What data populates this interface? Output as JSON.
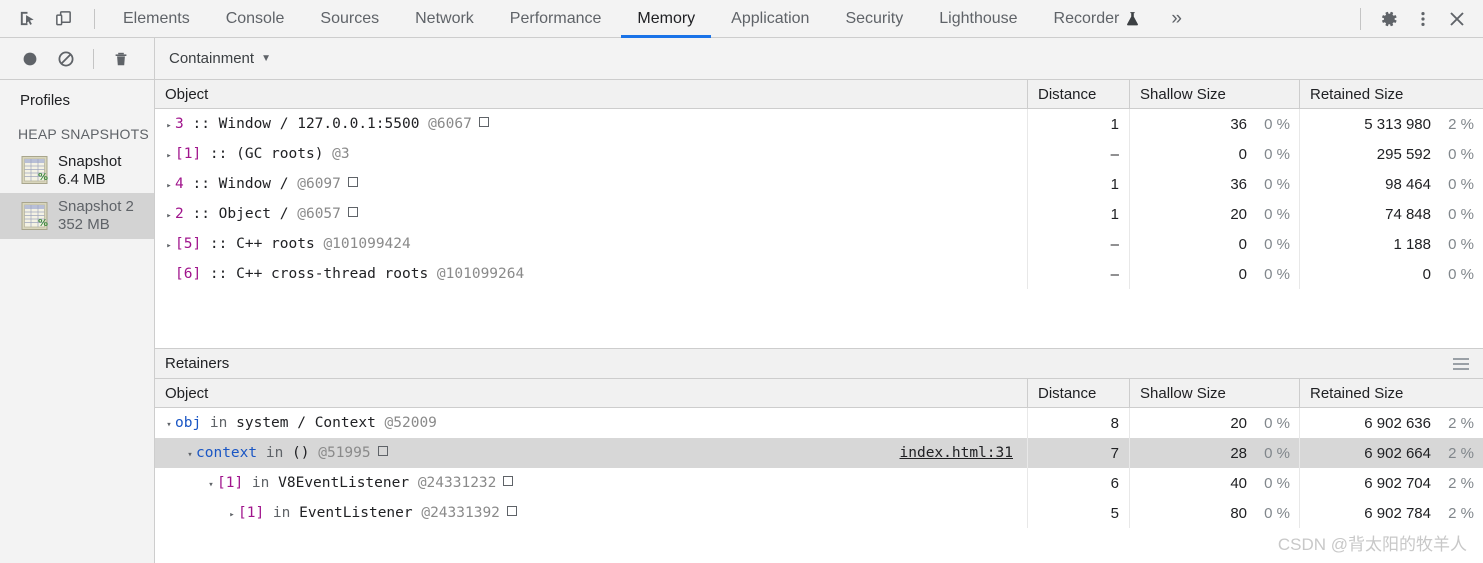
{
  "tabbar": {
    "inspect_icon": "inspect-element-icon",
    "device_icon": "device-toolbar-icon",
    "tabs": [
      {
        "label": "Elements",
        "active": false
      },
      {
        "label": "Console",
        "active": false
      },
      {
        "label": "Sources",
        "active": false
      },
      {
        "label": "Network",
        "active": false
      },
      {
        "label": "Performance",
        "active": false
      },
      {
        "label": "Memory",
        "active": true
      },
      {
        "label": "Application",
        "active": false
      },
      {
        "label": "Security",
        "active": false
      },
      {
        "label": "Lighthouse",
        "active": false
      },
      {
        "label": "Recorder",
        "active": false,
        "badge": "flask-icon"
      }
    ],
    "more_label": "»",
    "settings_icon": "gear-icon",
    "kebab_icon": "more-options-icon",
    "close_icon": "close-icon"
  },
  "toolbar": {
    "record_label": "record-icon",
    "clear_label": "no-entry-icon",
    "trash_label": "trash-icon",
    "view_select": "Containment",
    "caret": "▼"
  },
  "sidebar": {
    "title": "Profiles",
    "group_label": "HEAP SNAPSHOTS",
    "items": [
      {
        "name": "Snapshot",
        "size": "6.4 MB",
        "selected": false
      },
      {
        "name": "Snapshot 2",
        "size": "352 MB",
        "selected": true
      }
    ]
  },
  "main_table": {
    "columns": [
      "Object",
      "Distance",
      "Shallow Size",
      "Retained Size"
    ],
    "rows": [
      {
        "tri": "▸",
        "indent": 0,
        "parts": [
          {
            "t": "3",
            "c": "idx"
          },
          {
            "t": " :: ",
            "c": "plain"
          },
          {
            "t": "Window / 127.0.0.1:5500 ",
            "c": "plain"
          },
          {
            "t": "@6067",
            "c": "at"
          }
        ],
        "box": true,
        "distance": "1",
        "shallow": "36",
        "shallow_pct": "0 %",
        "retained": "5 313 980",
        "retained_pct": "2 %"
      },
      {
        "tri": "▸",
        "indent": 0,
        "parts": [
          {
            "t": "[1]",
            "c": "idx"
          },
          {
            "t": " :: ",
            "c": "plain"
          },
          {
            "t": "(GC roots) ",
            "c": "plain"
          },
          {
            "t": "@3",
            "c": "at"
          }
        ],
        "box": false,
        "distance": "–",
        "shallow": "0",
        "shallow_pct": "0 %",
        "retained": "295 592",
        "retained_pct": "0 %"
      },
      {
        "tri": "▸",
        "indent": 0,
        "parts": [
          {
            "t": "4",
            "c": "idx"
          },
          {
            "t": " :: ",
            "c": "plain"
          },
          {
            "t": "Window /  ",
            "c": "plain"
          },
          {
            "t": "@6097",
            "c": "at"
          }
        ],
        "box": true,
        "distance": "1",
        "shallow": "36",
        "shallow_pct": "0 %",
        "retained": "98 464",
        "retained_pct": "0 %"
      },
      {
        "tri": "▸",
        "indent": 0,
        "parts": [
          {
            "t": "2",
            "c": "idx"
          },
          {
            "t": " :: ",
            "c": "plain"
          },
          {
            "t": "Object /  ",
            "c": "plain"
          },
          {
            "t": "@6057",
            "c": "at"
          }
        ],
        "box": true,
        "distance": "1",
        "shallow": "20",
        "shallow_pct": "0 %",
        "retained": "74 848",
        "retained_pct": "0 %"
      },
      {
        "tri": "▸",
        "indent": 0,
        "parts": [
          {
            "t": "[5]",
            "c": "idx"
          },
          {
            "t": " :: ",
            "c": "plain"
          },
          {
            "t": "C++ roots ",
            "c": "plain"
          },
          {
            "t": "@101099424",
            "c": "at"
          }
        ],
        "box": false,
        "distance": "–",
        "shallow": "0",
        "shallow_pct": "0 %",
        "retained": "1 188",
        "retained_pct": "0 %"
      },
      {
        "tri": "",
        "indent": 0,
        "parts": [
          {
            "t": "[6]",
            "c": "idx"
          },
          {
            "t": " :: ",
            "c": "plain"
          },
          {
            "t": "C++ cross-thread roots ",
            "c": "plain"
          },
          {
            "t": "@101099264",
            "c": "at"
          }
        ],
        "box": false,
        "distance": "–",
        "shallow": "0",
        "shallow_pct": "0 %",
        "retained": "0",
        "retained_pct": "0 %"
      }
    ]
  },
  "retainers": {
    "section_title": "Retainers",
    "menu_icon": "hamburger-menu-icon",
    "columns": [
      "Object",
      "Distance",
      "Shallow Size",
      "Retained Size"
    ],
    "rows": [
      {
        "tri": "▾",
        "indent": 0,
        "selected": false,
        "parts": [
          {
            "t": "obj",
            "c": "prop"
          },
          {
            "t": " in ",
            "c": "inword"
          },
          {
            "t": "system / Context ",
            "c": "plain"
          },
          {
            "t": "@52009",
            "c": "at"
          }
        ],
        "box": false,
        "link": "",
        "distance": "8",
        "shallow": "20",
        "shallow_pct": "0 %",
        "retained": "6 902 636",
        "retained_pct": "2 %"
      },
      {
        "tri": "▾",
        "indent": 1,
        "selected": true,
        "parts": [
          {
            "t": "context",
            "c": "prop"
          },
          {
            "t": " in ",
            "c": "inword"
          },
          {
            "t": "() ",
            "c": "plain"
          },
          {
            "t": "@51995",
            "c": "at"
          }
        ],
        "box": true,
        "link": "index.html:31",
        "distance": "7",
        "shallow": "28",
        "shallow_pct": "0 %",
        "retained": "6 902 664",
        "retained_pct": "2 %"
      },
      {
        "tri": "▾",
        "indent": 2,
        "selected": false,
        "parts": [
          {
            "t": "[1]",
            "c": "idx"
          },
          {
            "t": " in ",
            "c": "inword"
          },
          {
            "t": "V8EventListener ",
            "c": "plain"
          },
          {
            "t": "@24331232",
            "c": "at"
          }
        ],
        "box": true,
        "link": "",
        "distance": "6",
        "shallow": "40",
        "shallow_pct": "0 %",
        "retained": "6 902 704",
        "retained_pct": "2 %"
      },
      {
        "tri": "▸",
        "indent": 3,
        "selected": false,
        "parts": [
          {
            "t": "[1]",
            "c": "idx"
          },
          {
            "t": " in ",
            "c": "inword"
          },
          {
            "t": "EventListener ",
            "c": "plain"
          },
          {
            "t": "@24331392",
            "c": "at"
          }
        ],
        "box": true,
        "link": "",
        "distance": "5",
        "shallow": "80",
        "shallow_pct": "0 %",
        "retained": "6 902 784",
        "retained_pct": "2 %"
      }
    ]
  },
  "watermark": "CSDN @背太阳的牧羊人",
  "colors": {
    "accent": "#1a73e8",
    "index_purple": "#a0148c",
    "property_blue": "#1a56c4",
    "toolbar_bg": "#f3f3f3",
    "selected_row": "#d7d7d7"
  }
}
